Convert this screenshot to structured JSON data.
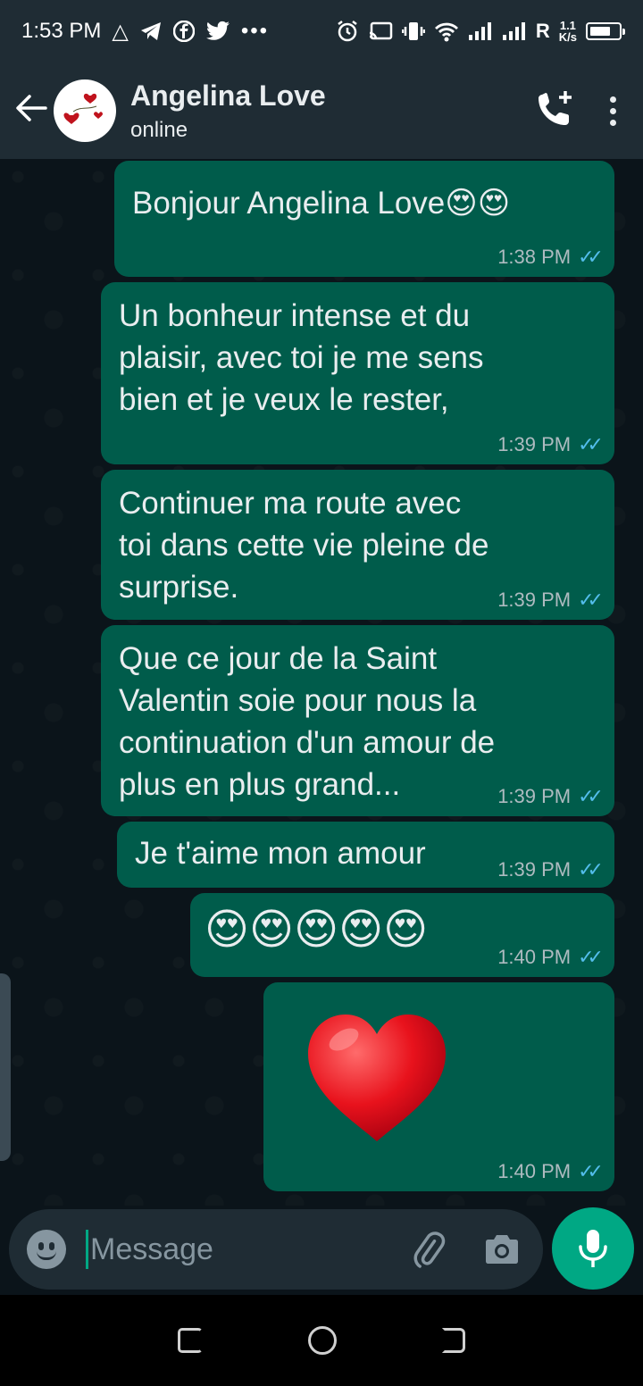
{
  "status_bar": {
    "time": "1:53 PM",
    "left_icons": [
      "alert-triangle-icon",
      "telegram-icon",
      "facebook-icon",
      "twitter-icon",
      "more-dots-icon"
    ],
    "right_icons": [
      "alarm-icon",
      "cast-icon",
      "vibrate-icon",
      "wifi-icon",
      "signal-icon",
      "signal-icon"
    ],
    "roaming": "R",
    "speed_value": "1.1",
    "speed_unit": "K/s"
  },
  "header": {
    "contact_name": "Angelina Love",
    "contact_status": "online"
  },
  "messages": [
    {
      "text": "Bonjour Angelina Love😍😍",
      "time": "1:38 PM"
    },
    {
      "text": "Un bonheur intense et du\nplaisir, avec toi je me sens\nbien et je veux le rester,",
      "time": "1:39 PM"
    },
    {
      "text": "Continuer ma route avec\ntoi dans cette vie pleine de\nsurprise.",
      "time": "1:39 PM"
    },
    {
      "text": "Que ce jour de la Saint\nValentin soie pour nous la\ncontinuation d'un amour de\nplus en plus grand...",
      "time": "1:39 PM"
    },
    {
      "text": "Je t'aime mon amour",
      "time": "1:39 PM"
    },
    {
      "text": "😍😍😍😍😍",
      "time": "1:40 PM"
    },
    {
      "text": "",
      "time": "1:40 PM"
    }
  ],
  "composer": {
    "placeholder": "Message"
  },
  "colors": {
    "outgoing_bubble": "#005c4b",
    "header_bg": "#1f2c34",
    "chat_bg": "#0b141a",
    "accent": "#00a884",
    "read_ticks": "#53bdeb"
  }
}
